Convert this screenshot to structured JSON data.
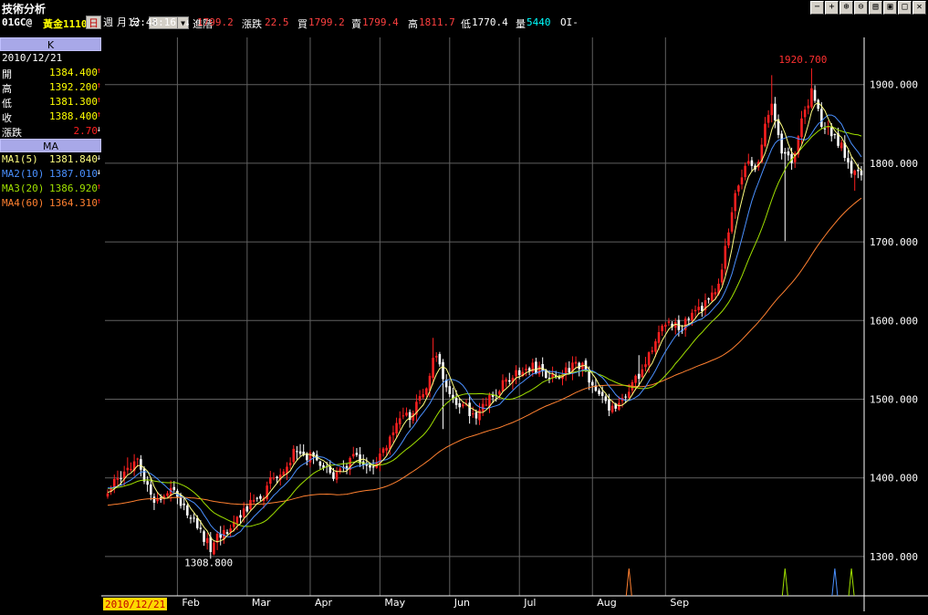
{
  "window": {
    "title": "技術分析",
    "buttons": [
      {
        "name": "minus-button",
        "glyph": "−"
      },
      {
        "name": "plus-button",
        "glyph": "+"
      },
      {
        "name": "zoom-in-icon",
        "glyph": "⊕"
      },
      {
        "name": "zoom-out-icon",
        "glyph": "⊖"
      },
      {
        "name": "print-icon",
        "glyph": "▤"
      },
      {
        "name": "save-icon",
        "glyph": "▣"
      },
      {
        "name": "maximize-icon",
        "glyph": "□"
      },
      {
        "name": "close-icon",
        "glyph": "✕"
      }
    ]
  },
  "quote": {
    "symbol": "01GC@",
    "name": "黃金1110(日)",
    "time": "12:48:16",
    "arrow": "↓",
    "last": "1799.2",
    "change_label": "漲跌",
    "change": "22.5",
    "bid_label": "買",
    "bid": "1799.2",
    "ask_label": "賣",
    "ask": "1799.4",
    "high_label": "高",
    "high": "1811.7",
    "low_label": "低",
    "low": "1770.4",
    "volume_label": "量",
    "volume": "5440",
    "oi_label": "OI-",
    "colors": {
      "down": "#ff2020",
      "label": "#ffffff",
      "value_red": "#ff4040",
      "volume": "#00ffff"
    }
  },
  "periods": {
    "items": [
      "日",
      "週",
      "月",
      "分"
    ],
    "active": "日",
    "minutes_value": "5",
    "advanced_label": "進階"
  },
  "kpanel": {
    "header": "K",
    "date": "2010/12/21",
    "rows": [
      {
        "label": "開",
        "value": "1384.400",
        "dir": "↑",
        "color": "#ffff00"
      },
      {
        "label": "高",
        "value": "1392.200",
        "dir": "↑",
        "color": "#ffff00"
      },
      {
        "label": "低",
        "value": "1381.300",
        "dir": "↑",
        "color": "#ffff00"
      },
      {
        "label": "收",
        "value": "1388.400",
        "dir": "↑",
        "color": "#ffff00"
      },
      {
        "label": "漲跌",
        "value": "2.70",
        "dir": "↓",
        "color": "#ff2020"
      }
    ]
  },
  "mapanel": {
    "header": "MA",
    "rows": [
      {
        "label": "MA1(5)",
        "value": "1381.840",
        "dir": "↓",
        "color": "#ffff80"
      },
      {
        "label": "MA2(10)",
        "value": "1387.010",
        "dir": "↓",
        "color": "#4a90ff"
      },
      {
        "label": "MA3(20)",
        "value": "1386.920",
        "dir": "↑",
        "color": "#a0e000"
      },
      {
        "label": "MA4(60)",
        "value": "1364.310",
        "dir": "↑",
        "color": "#ff8030"
      }
    ]
  },
  "chart_data": {
    "type": "candlestick",
    "title": "",
    "xlabel": "",
    "ylabel": "",
    "ylim": [
      1250,
      1960
    ],
    "yticks": [
      "1300.000",
      "1400.000",
      "1500.000",
      "1600.000",
      "1700.000",
      "1800.000",
      "1900.000"
    ],
    "ytick_values": [
      1300,
      1400,
      1500,
      1600,
      1700,
      1800,
      1900
    ],
    "x_start_label": "2010/12/21",
    "month_labels": [
      "Feb",
      "Mar",
      "Apr",
      "May",
      "Jun",
      "Jul",
      "Aug",
      "Sep"
    ],
    "annotations": [
      {
        "text": "1920.700",
        "value": 1920.7,
        "color": "#ff3030"
      },
      {
        "text": "1308.800",
        "value": 1308.8,
        "color": "#ffffff"
      }
    ],
    "grid": true,
    "colors": {
      "up": "#ff2020",
      "down": "#ffffff",
      "bg": "#000000",
      "grid": "#606060",
      "ma5": "#ffff80",
      "ma10": "#4a90ff",
      "ma20": "#a0e000",
      "ma60": "#ff8030"
    },
    "close_path": [
      [
        0,
        1385
      ],
      [
        3,
        1395
      ],
      [
        7,
        1415
      ],
      [
        9,
        1425
      ],
      [
        12,
        1385
      ],
      [
        15,
        1370
      ],
      [
        18,
        1385
      ],
      [
        20,
        1378
      ],
      [
        23,
        1360
      ],
      [
        26,
        1345
      ],
      [
        28,
        1330
      ],
      [
        31,
        1312
      ],
      [
        33,
        1322
      ],
      [
        36,
        1330
      ],
      [
        38,
        1345
      ],
      [
        41,
        1360
      ],
      [
        44,
        1368
      ],
      [
        47,
        1378
      ],
      [
        49,
        1395
      ],
      [
        52,
        1410
      ],
      [
        55,
        1425
      ],
      [
        57,
        1435
      ],
      [
        60,
        1428
      ],
      [
        63,
        1420
      ],
      [
        66,
        1408
      ],
      [
        68,
        1400
      ],
      [
        71,
        1408
      ],
      [
        74,
        1425
      ],
      [
        77,
        1418
      ],
      [
        80,
        1410
      ],
      [
        82,
        1430
      ],
      [
        85,
        1450
      ],
      [
        88,
        1470
      ],
      [
        91,
        1480
      ],
      [
        93,
        1495
      ],
      [
        96,
        1510
      ],
      [
        98,
        1555
      ],
      [
        100,
        1545
      ],
      [
        103,
        1500
      ],
      [
        105,
        1490
      ],
      [
        108,
        1488
      ],
      [
        111,
        1480
      ],
      [
        114,
        1495
      ],
      [
        117,
        1510
      ],
      [
        120,
        1522
      ],
      [
        122,
        1532
      ],
      [
        125,
        1538
      ],
      [
        128,
        1540
      ],
      [
        131,
        1535
      ],
      [
        134,
        1525
      ],
      [
        137,
        1532
      ],
      [
        140,
        1545
      ],
      [
        143,
        1540
      ],
      [
        146,
        1522
      ],
      [
        149,
        1500
      ],
      [
        152,
        1488
      ],
      [
        154,
        1495
      ],
      [
        157,
        1508
      ],
      [
        160,
        1532
      ],
      [
        163,
        1560
      ],
      [
        166,
        1585
      ],
      [
        169,
        1600
      ],
      [
        172,
        1590
      ],
      [
        175,
        1600
      ],
      [
        178,
        1612
      ],
      [
        181,
        1625
      ],
      [
        184,
        1650
      ],
      [
        187,
        1710
      ],
      [
        189,
        1755
      ],
      [
        192,
        1800
      ],
      [
        195,
        1790
      ],
      [
        198,
        1845
      ],
      [
        200,
        1880
      ],
      [
        203,
        1810
      ],
      [
        206,
        1800
      ],
      [
        209,
        1850
      ],
      [
        212,
        1890
      ],
      [
        215,
        1850
      ],
      [
        218,
        1840
      ],
      [
        221,
        1820
      ],
      [
        224,
        1790
      ],
      [
        227,
        1790
      ]
    ],
    "wick_marks": [
      {
        "t": 6,
        "high": 1426
      },
      {
        "t": 30,
        "high": 1330,
        "low": 1308.8
      },
      {
        "t": 98,
        "high": 1578
      },
      {
        "t": 101,
        "low": 1462
      },
      {
        "t": 160,
        "high": 1556
      },
      {
        "t": 200,
        "high": 1912
      },
      {
        "t": 204,
        "low": 1701
      },
      {
        "t": 212,
        "high": 1920.7
      },
      {
        "t": 225,
        "low": 1765
      }
    ],
    "volume_markers": [
      {
        "t": 157,
        "color": "#ff8030"
      },
      {
        "t": 204,
        "color": "#a0e000"
      },
      {
        "t": 219,
        "color": "#4a90ff"
      },
      {
        "t": 224,
        "color": "#a0e000"
      }
    ]
  }
}
